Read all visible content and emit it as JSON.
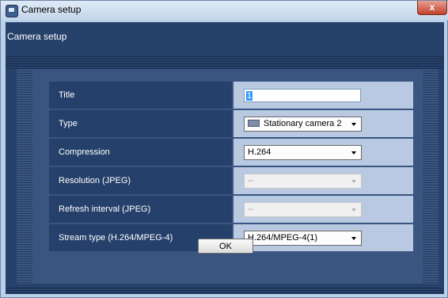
{
  "window": {
    "title": "Camera setup",
    "close_label": "x"
  },
  "header": {
    "title": "Camera setup"
  },
  "form": {
    "rows": [
      {
        "label": "Title",
        "value": "1"
      },
      {
        "label": "Type",
        "value": "Stationary camera 2",
        "icon": "camera-icon"
      },
      {
        "label": "Compression",
        "value": "H.264"
      },
      {
        "label": "Resolution (JPEG)",
        "value": "--",
        "disabled": true
      },
      {
        "label": "Refresh interval (JPEG)",
        "value": "--",
        "disabled": true
      },
      {
        "label": "Stream type (H.264/MPEG-4)",
        "value": "H.264/MPEG-4(1)"
      }
    ]
  },
  "footer": {
    "ok_label": "OK"
  },
  "colors": {
    "background": "#26416a",
    "label_cell": "#25406b",
    "value_cell": "#b8c9e1",
    "title_bar": "#c4d6ea"
  }
}
